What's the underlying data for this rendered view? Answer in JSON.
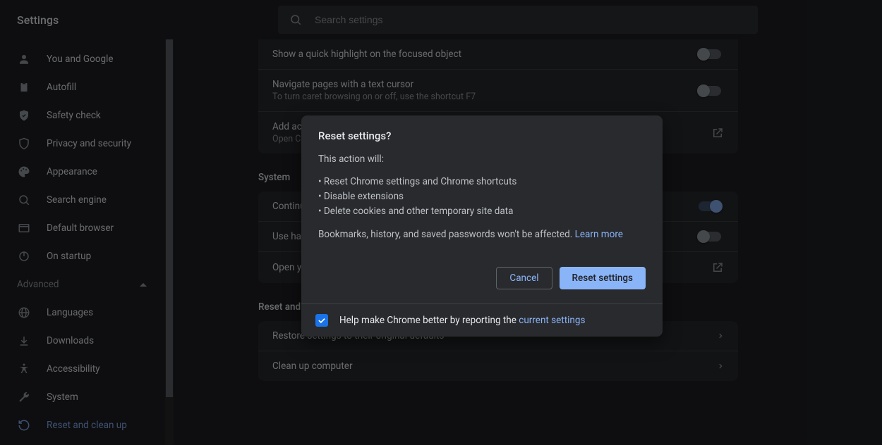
{
  "app": {
    "title": "Settings"
  },
  "search": {
    "placeholder": "Search settings"
  },
  "sidebar": {
    "items": [
      {
        "label": "You and Google"
      },
      {
        "label": "Autofill"
      },
      {
        "label": "Safety check"
      },
      {
        "label": "Privacy and security"
      },
      {
        "label": "Appearance"
      },
      {
        "label": "Search engine"
      },
      {
        "label": "Default browser"
      },
      {
        "label": "On startup"
      }
    ],
    "advanced_label": "Advanced",
    "advanced": [
      {
        "label": "Languages"
      },
      {
        "label": "Downloads"
      },
      {
        "label": "Accessibility"
      },
      {
        "label": "System"
      },
      {
        "label": "Reset and clean up"
      }
    ]
  },
  "content": {
    "accessibility_rows": [
      {
        "label": "Show a quick highlight on the focused object",
        "sub": "",
        "state": "off",
        "kind": "toggle"
      },
      {
        "label": "Navigate pages with a text cursor",
        "sub": "To turn caret browsing on or off, use the shortcut F7",
        "state": "off",
        "kind": "toggle"
      },
      {
        "label": "Add accessibility features",
        "sub": "Open Chrome Web Store",
        "state": "",
        "kind": "external"
      }
    ],
    "system_title": "System",
    "system_rows": [
      {
        "label": "Continue running background apps when Google Chrome is closed",
        "state": "on",
        "kind": "toggle"
      },
      {
        "label": "Use hardware acceleration when available",
        "state": "off",
        "kind": "toggle"
      },
      {
        "label": "Open your computer's proxy settings",
        "state": "",
        "kind": "external"
      }
    ],
    "reset_title": "Reset and clean up",
    "reset_rows": [
      {
        "label": "Restore settings to their original defaults"
      },
      {
        "label": "Clean up computer"
      }
    ]
  },
  "dialog": {
    "title": "Reset settings?",
    "intro": "This action will:",
    "bullets": [
      "Reset Chrome settings and Chrome shortcuts",
      "Disable extensions",
      "Delete cookies and other temporary site data"
    ],
    "note_pre": "Bookmarks, history, and saved passwords won't be affected. ",
    "note_link": "Learn more",
    "cancel": "Cancel",
    "confirm": "Reset settings",
    "help_text_pre": "Help make Chrome better by reporting the ",
    "help_link": "current settings",
    "help_checked": true
  }
}
